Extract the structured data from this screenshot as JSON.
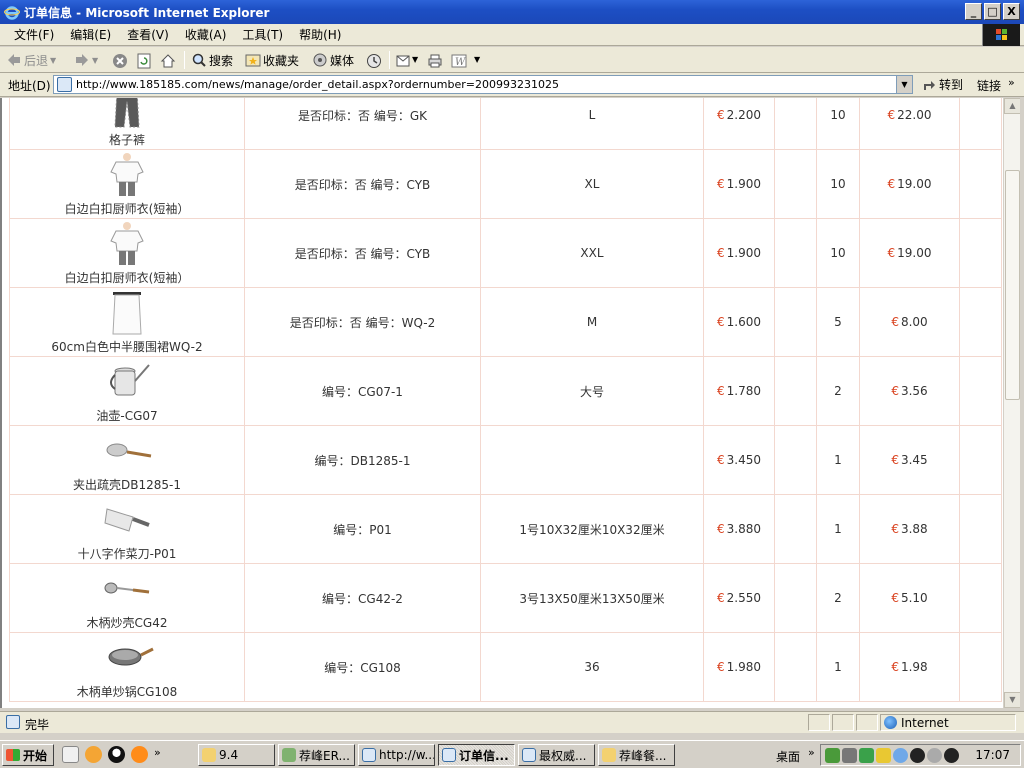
{
  "window": {
    "title": "订单信息 - Microsoft Internet Explorer",
    "buttons": {
      "minimize": "_",
      "maximize": "□",
      "close": "X"
    }
  },
  "menu": [
    "文件(F)",
    "编辑(E)",
    "查看(V)",
    "收藏(A)",
    "工具(T)",
    "帮助(H)"
  ],
  "toolbar": {
    "back": "后退",
    "search": "搜索",
    "favorites": "收藏夹",
    "media": "媒体"
  },
  "address": {
    "label": "地址(D)",
    "url": "http://www.185185.com/news/manage/order_detail.aspx?ordernumber=200993231025",
    "go": "转到",
    "links": "链接"
  },
  "currency_symbol": "€",
  "orders": [
    {
      "name": "格子裤",
      "spec": "是否印标：否  编号：GK",
      "size": "L",
      "price": "2.200",
      "qty": "10",
      "total": "22.00",
      "icon": "pants-icon"
    },
    {
      "name": "白边白扣厨师衣(短袖）",
      "spec": "是否印标：否  编号：CYB",
      "size": "XL",
      "price": "1.900",
      "qty": "10",
      "total": "19.00",
      "icon": "chef-shirt-icon"
    },
    {
      "name": "白边白扣厨师衣(短袖）",
      "spec": "是否印标：否  编号：CYB",
      "size": "XXL",
      "price": "1.900",
      "qty": "10",
      "total": "19.00",
      "icon": "chef-shirt-icon"
    },
    {
      "name": "60cm白色中半腰围裙WQ-2",
      "spec": "是否印标：否  编号：WQ-2",
      "size": "M",
      "price": "1.600",
      "qty": "5",
      "total": "8.00",
      "icon": "apron-icon"
    },
    {
      "name": "油壶-CG07",
      "spec": "编号：CG07-1",
      "size": "大号",
      "price": "1.780",
      "qty": "2",
      "total": "3.56",
      "icon": "oil-pot-icon"
    },
    {
      "name": "夹出疏壳DB1285-1",
      "spec": "编号：DB1285-1",
      "size": "",
      "price": "3.450",
      "qty": "1",
      "total": "3.45",
      "icon": "skimmer-icon"
    },
    {
      "name": "十八字作菜刀-P01",
      "spec": "编号：P01",
      "size": "1号10X32厘米10X32厘米",
      "price": "3.880",
      "qty": "1",
      "total": "3.88",
      "icon": "cleaver-icon"
    },
    {
      "name": "木柄炒壳CG42",
      "spec": "编号：CG42-2",
      "size": "3号13X50厘米13X50厘米",
      "price": "2.550",
      "qty": "2",
      "total": "5.10",
      "icon": "ladle-icon"
    },
    {
      "name": "木柄单炒锅CG108",
      "spec": "编号：CG108",
      "size": "36",
      "price": "1.980",
      "qty": "1",
      "total": "1.98",
      "icon": "wok-icon"
    }
  ],
  "status": {
    "text": "完毕",
    "zone": "Internet"
  },
  "taskbar": {
    "start": "开始",
    "tasks": [
      "9.4",
      "荐峰ER...",
      "http://w...",
      "订单信...",
      "最权威...",
      "荐峰餐..."
    ],
    "desktop": "桌面",
    "clock": "17:07"
  }
}
